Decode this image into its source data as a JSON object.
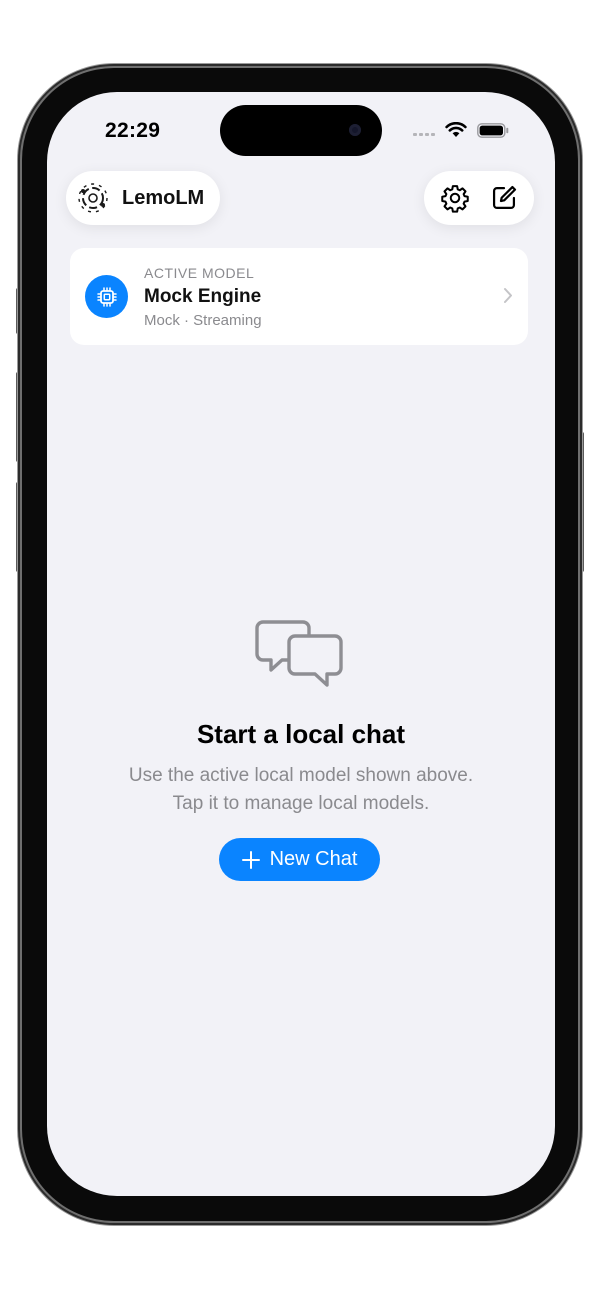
{
  "status_bar": {
    "time": "22:29"
  },
  "nav": {
    "app_name": "LemoLM",
    "logo_icon": "app-logo-icon",
    "settings_icon": "gear-icon",
    "compose_icon": "compose-icon"
  },
  "active_model": {
    "overline": "ACTIVE MODEL",
    "name": "Mock Engine",
    "meta": "Mock · Streaming",
    "icon": "cpu-chip-icon"
  },
  "empty_state": {
    "icon": "chat-bubbles-icon",
    "title": "Start a local chat",
    "subtitle_line1": "Use the active local model shown above.",
    "subtitle_line2": "Tap it to manage local models.",
    "button_label": "New Chat"
  },
  "colors": {
    "accent": "#0a84ff",
    "background": "#f2f2f7",
    "secondary_text": "#8a8a8e"
  }
}
